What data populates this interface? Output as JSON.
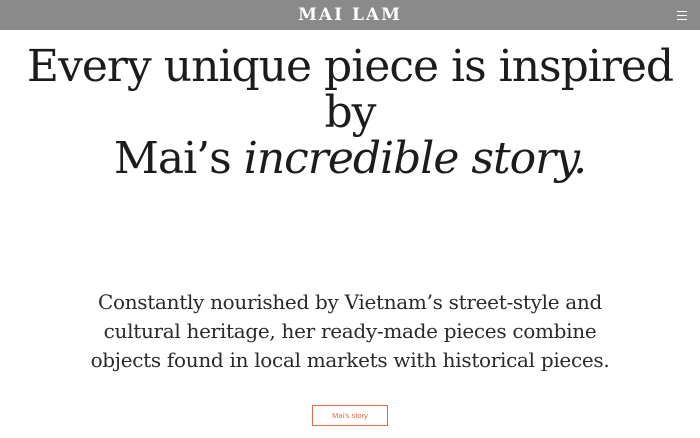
{
  "header": {
    "logo_text": "MAI LAM",
    "menu_icon": "hamburger-menu-icon"
  },
  "hero": {
    "headline_line1": "Every unique piece is inspired by",
    "headline_line2_plain": "Mai’s ",
    "headline_line2_italic": "incredible story."
  },
  "intro": {
    "paragraph": "Constantly nourished by Vietnam’s street-style and cultural heritage, her ready-made pieces combine objects found in local markets with historical pieces."
  },
  "cta": {
    "label": "Mai’s story"
  },
  "colors": {
    "topbar": "#8a8a8a",
    "accent": "#e8694a",
    "text": "#1c1c1c",
    "background": "#ffffff"
  }
}
